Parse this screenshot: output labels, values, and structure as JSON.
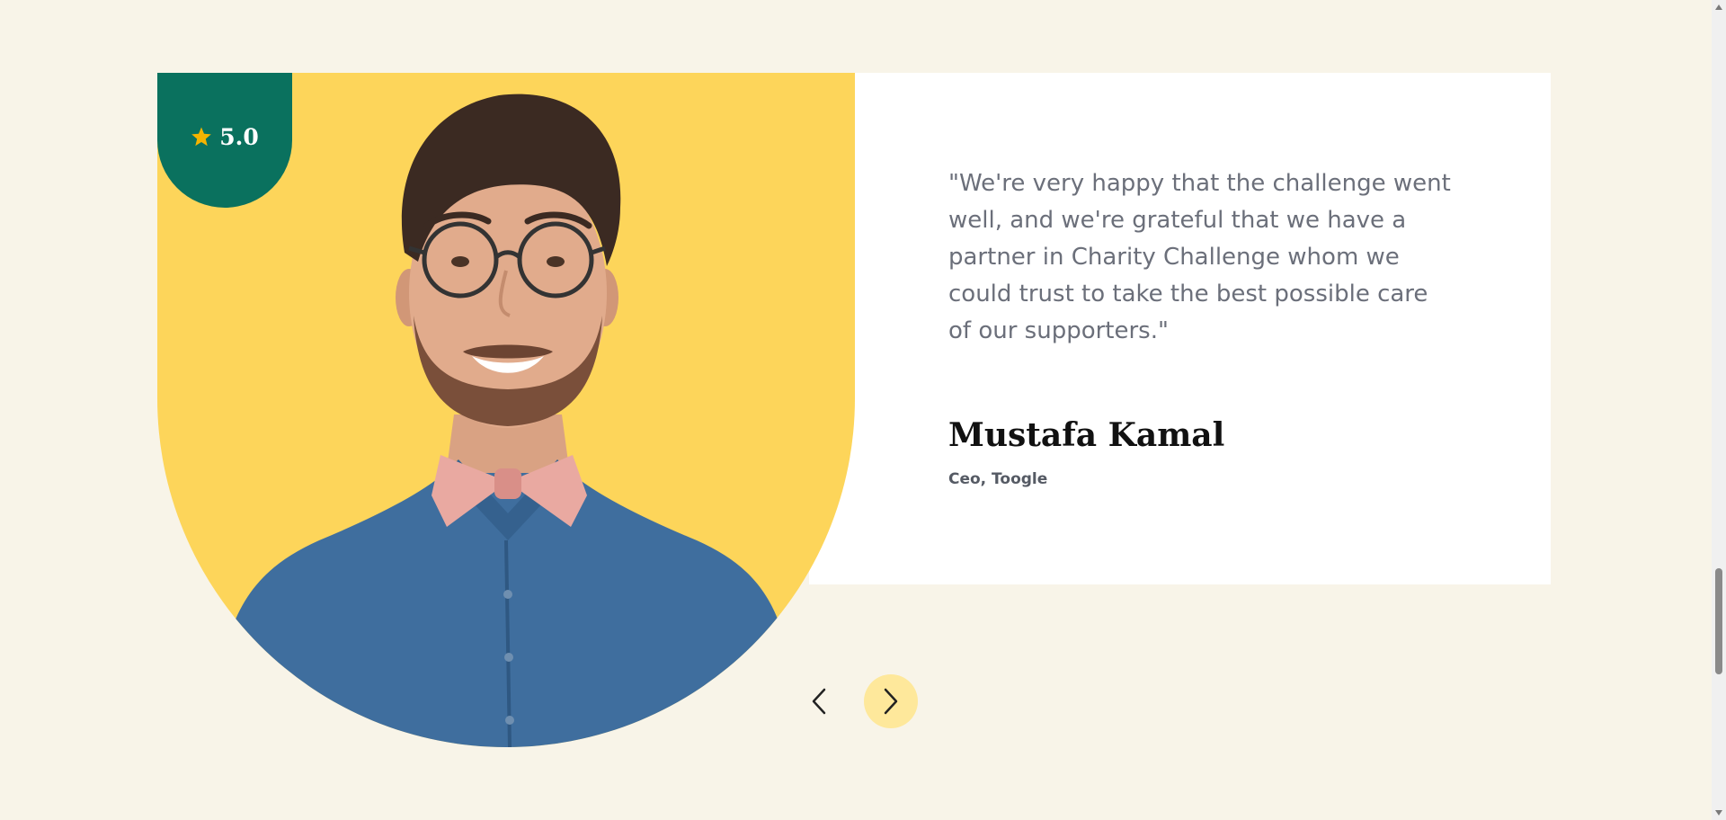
{
  "testimonial": {
    "rating": "5.0",
    "quote": "\"We're very happy that the challenge went well, and we're grateful that we have a partner in Charity Challenge whom we could trust to take the best possible care of our supporters.\"",
    "author_name": "Mustafa Kamal",
    "author_role": "Ceo, Toogle"
  },
  "navigation": {
    "prev_icon": "chevron-left-icon",
    "next_icon": "chevron-right-icon"
  },
  "colors": {
    "background": "#f8f4e8",
    "accent_yellow": "#fdd55a",
    "badge_green": "#0a715e",
    "star_gold": "#f5b400",
    "next_button": "#fee89b"
  }
}
